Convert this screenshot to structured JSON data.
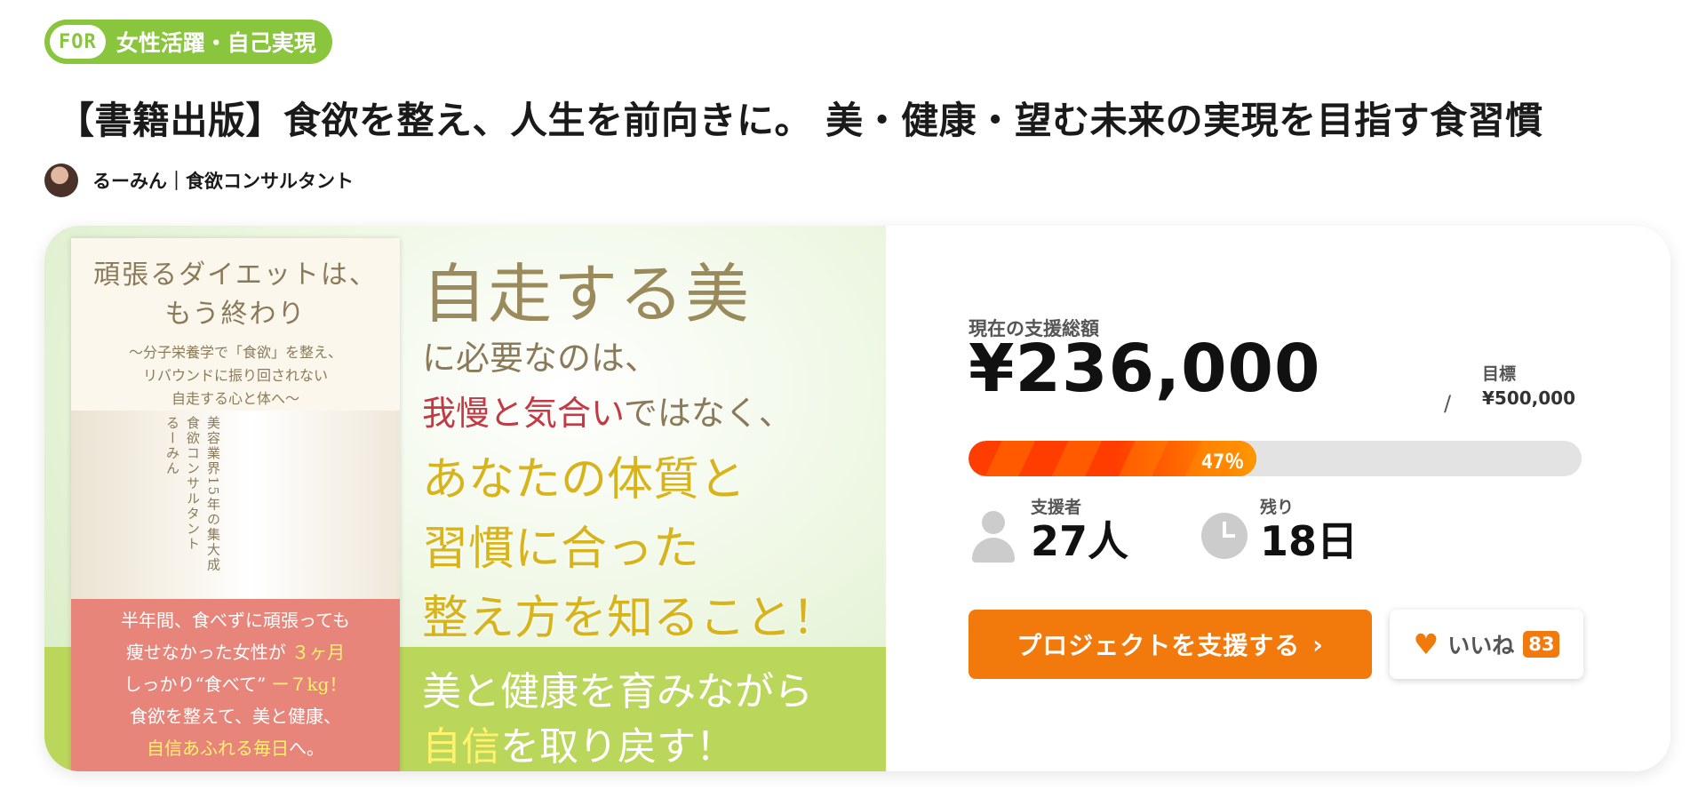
{
  "category": {
    "for_label": "FOR",
    "name": "女性活躍・自己実現"
  },
  "project": {
    "title": "【書籍出版】食欲を整え、人生を前向きに。 美・健康・望む未来の実現を目指す食習慣",
    "author": "るーみん｜食欲コンサルタント"
  },
  "hero": {
    "book": {
      "title_line1": "頑張るダイエットは、",
      "title_line2": "もう終わり",
      "subtitle": "〜分子栄養学で「食欲」を整え、\nリバウンドに振り回されない\n自走する心と体へ〜",
      "vertical_1": "美容業界15年の集大成",
      "vertical_2": "食欲コンサルタント",
      "vertical_3": "るーみん",
      "band_line1": "半年間、食べずに頑張っても",
      "band_line2a": "痩せなかった女性が",
      "band_line2b": "３ヶ月",
      "band_line3a": "しっかり“食べて”",
      "band_line3b": "ー７kg！",
      "band_line4": "食欲を整えて、美と健康、",
      "band_line5a": "自信あふれる毎日",
      "band_line5b": "へ。"
    },
    "headline_1": "自走する美",
    "headline_2": "に必要なのは、",
    "headline_3_red": "我慢と気合い",
    "headline_3_rest": "ではなく、",
    "headline_4": "あなたの体質と",
    "headline_5": "習慣に合った",
    "headline_6": "整え方を知ること！",
    "headline_7": "美と健康を育みながら",
    "headline_8_yellow": "自信",
    "headline_8_rest": "を取り戻す！"
  },
  "stats": {
    "raised_label": "現在の支援総額",
    "raised_amount": "¥236,000",
    "goal_separator": "/",
    "goal_label": "目標",
    "goal_amount": "¥500,000",
    "progress_text": "47％",
    "progress_fraction": 0.47,
    "supporters_label": "支援者",
    "supporters_value": "27人",
    "remaining_label": "残り",
    "remaining_value": "18日"
  },
  "actions": {
    "support_button": "プロジェクトを支援する",
    "support_chevron": "›",
    "like_icon": "♥",
    "like_label": "いいね",
    "like_count": "83"
  },
  "colors": {
    "brand_green": "#8ac53e",
    "accent_orange": "#f27a0d",
    "progress_red": "#ff3d00",
    "hero_band_green": "#bad65b",
    "book_band_pink": "#e8857a"
  },
  "icons": {
    "supporters": "person-icon",
    "remaining": "clock-icon",
    "like": "heart-icon"
  }
}
